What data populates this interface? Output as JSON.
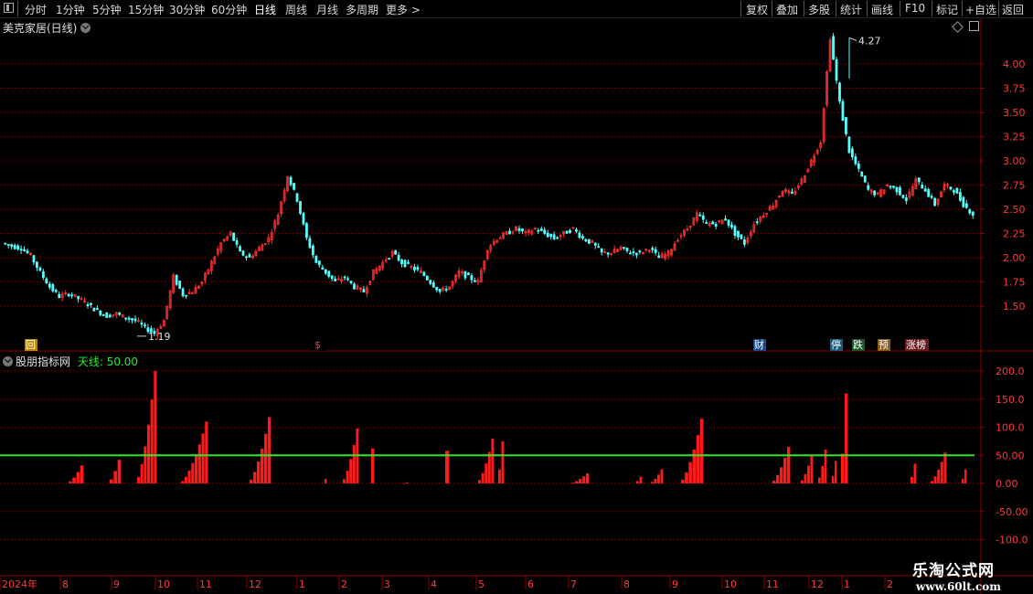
{
  "toolbar": {
    "periods": [
      "分时",
      "1分钟",
      "5分钟",
      "15分钟",
      "30分钟",
      "60分钟",
      "日线",
      "周线",
      "月线",
      "多周期",
      "更多 >"
    ],
    "active_period": "日线",
    "buttons": [
      "复权",
      "叠加",
      "多股",
      "统计",
      "画线",
      "F10",
      "标记",
      "+自选",
      "返回"
    ]
  },
  "main_chart": {
    "title": "美克家居(日线)",
    "high_label": "4.27",
    "low_label": "1.19",
    "y_ticks": [
      "4.00",
      "3.75",
      "3.50",
      "3.25",
      "3.00",
      "2.75",
      "2.50",
      "2.25",
      "2.00",
      "1.75",
      "1.50"
    ],
    "ylim": [
      1.25,
      4.5
    ],
    "events": [
      {
        "label": "回",
        "bg": "#b8860b",
        "color": "#ffffff"
      },
      {
        "label": "$",
        "bg": "#000000",
        "color": "#ff4040"
      },
      {
        "label": "财",
        "bg": "#1a4a8a",
        "color": "#ffffff"
      },
      {
        "label": "停",
        "bg": "#1a5a7a",
        "color": "#ffffff"
      },
      {
        "label": "跌",
        "bg": "#1a5a2a",
        "color": "#ffffff"
      },
      {
        "label": "预",
        "bg": "#8a5a1a",
        "color": "#ffffff"
      },
      {
        "label": "涨榜",
        "bg": "#6a1a1a",
        "color": "#ffffff"
      }
    ]
  },
  "indicator": {
    "title": "股朋指标网",
    "line_label": "天线: 50.00",
    "line_value": 50,
    "y_ticks": [
      "200.0",
      "150.0",
      "100.0",
      "50.00",
      "0.00",
      "-50.00",
      "-100.0"
    ],
    "ylim": [
      -110,
      205
    ]
  },
  "date_axis": {
    "labels": [
      "2024年",
      "8",
      "9",
      "10",
      "11",
      "12",
      "1",
      "2",
      "3",
      "4",
      "5",
      "6",
      "7",
      "8",
      "9",
      "10",
      "11",
      "12",
      "1",
      "2"
    ]
  },
  "watermark": {
    "line1": "乐淘公式网",
    "line2": "www.60lt.com"
  },
  "colors": {
    "up": "#ff3030",
    "down": "#54ffff",
    "grid": "#8b0000",
    "signal": "#ff1a1a",
    "threshold": "#2ee82e"
  },
  "chart_data": [
    {
      "type": "candlestick",
      "title": "美克家居(日线)",
      "ylim": [
        1.25,
        4.5
      ],
      "annotations": [
        {
          "text": "4.27",
          "kind": "high"
        },
        {
          "text": "1.19",
          "kind": "low"
        }
      ],
      "close_path": [
        2.15,
        2.12,
        2.1,
        2.02,
        1.85,
        1.7,
        1.6,
        1.63,
        1.58,
        1.52,
        1.45,
        1.4,
        1.42,
        1.38,
        1.35,
        1.28,
        1.22,
        1.35,
        1.8,
        1.62,
        1.65,
        1.75,
        1.95,
        2.15,
        2.25,
        2.05,
        2.0,
        2.1,
        2.2,
        2.45,
        2.85,
        2.6,
        2.2,
        1.95,
        1.85,
        1.75,
        1.8,
        1.7,
        1.65,
        1.85,
        1.95,
        2.05,
        1.95,
        1.9,
        1.85,
        1.75,
        1.65,
        1.7,
        1.85,
        1.8,
        1.75,
        2.1,
        2.2,
        2.25,
        2.3,
        2.25,
        2.3,
        2.25,
        2.2,
        2.25,
        2.3,
        2.2,
        2.15,
        2.05,
        2.05,
        2.1,
        2.05,
        2.05,
        2.1,
        2.0,
        2.05,
        2.2,
        2.3,
        2.45,
        2.35,
        2.35,
        2.4,
        2.25,
        2.15,
        2.35,
        2.45,
        2.55,
        2.7,
        2.65,
        2.8,
        3.0,
        3.2,
        4.27,
        3.6,
        3.1,
        2.9,
        2.7,
        2.65,
        2.75,
        2.7,
        2.6,
        2.8,
        2.7,
        2.55,
        2.75,
        2.7,
        2.55,
        2.45
      ]
    },
    {
      "type": "bar",
      "title": "股朋指标网",
      "series": [
        {
          "name": "天线",
          "values": [
            50
          ]
        }
      ],
      "ylim": [
        -110,
        205
      ],
      "bars": [
        {
          "from": 75,
          "to": 92,
          "peak": 32
        },
        {
          "from": 120,
          "to": 133,
          "peak": 42
        },
        {
          "from": 150,
          "to": 172,
          "peak": 200
        },
        {
          "from": 198,
          "to": 228,
          "peak": 110
        },
        {
          "from": 273,
          "to": 297,
          "peak": 118
        },
        {
          "from": 355,
          "to": 358,
          "peak": 8
        },
        {
          "from": 375,
          "to": 393,
          "peak": 98
        },
        {
          "from": 406,
          "to": 410,
          "peak": 62
        },
        {
          "from": 441,
          "to": 447,
          "peak": 2
        },
        {
          "from": 487,
          "to": 492,
          "peak": 58
        },
        {
          "from": 523,
          "to": 541,
          "peak": 80
        },
        {
          "from": 545,
          "to": 552,
          "peak": 75
        },
        {
          "from": 625,
          "to": 645,
          "peak": 18
        },
        {
          "from": 696,
          "to": 703,
          "peak": 12
        },
        {
          "from": 712,
          "to": 726,
          "peak": 25
        },
        {
          "from": 745,
          "to": 770,
          "peak": 115
        },
        {
          "from": 845,
          "to": 865,
          "peak": 65
        },
        {
          "from": 876,
          "to": 890,
          "peak": 50
        },
        {
          "from": 895,
          "to": 905,
          "peak": 60
        },
        {
          "from": 910,
          "to": 916,
          "peak": 40
        },
        {
          "from": 920,
          "to": 928,
          "peak": 160
        },
        {
          "from": 996,
          "to": 1003,
          "peak": 35
        },
        {
          "from": 1018,
          "to": 1036,
          "peak": 55
        },
        {
          "from": 1052,
          "to": 1058,
          "peak": 25
        }
      ]
    }
  ]
}
